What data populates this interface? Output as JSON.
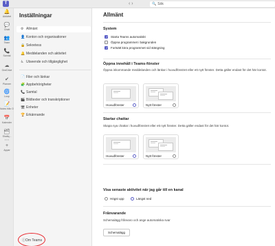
{
  "topbar": {
    "logo": "T",
    "nav": "‹ ›",
    "search": "Sök"
  },
  "rail": [
    {
      "icon": "🔔",
      "name": "bell-icon",
      "label": "Aktivitet"
    },
    {
      "icon": "💬",
      "name": "chat-icon",
      "label": "Chatt"
    },
    {
      "icon": "👥",
      "name": "teams-icon",
      "label": "Team"
    },
    {
      "icon": "📞",
      "name": "phone-icon",
      "label": "Samtal"
    },
    {
      "icon": "☁",
      "name": "onedrive-icon",
      "label": "OneDrive"
    },
    {
      "icon": "✔",
      "name": "planner-icon",
      "label": "Planner"
    },
    {
      "icon": "🌀",
      "name": "loop-icon",
      "label": "Loop"
    },
    {
      "icon": "📝",
      "name": "notes-icon",
      "label": "Notes från O..."
    },
    {
      "icon": "📅",
      "name": "calendar-icon",
      "label": "Kalender"
    },
    {
      "icon": "🗂",
      "name": "viva-icon",
      "label": "Shafiq..."
    },
    {
      "icon": "⋯",
      "name": "more-icon",
      "label": ""
    },
    {
      "icon": "+",
      "name": "apps-icon",
      "label": "Appar"
    }
  ],
  "settings": {
    "title": "Inställningar",
    "group1": [
      {
        "icon": "⚙",
        "name": "gear-icon",
        "label": "Allmänt"
      },
      {
        "icon": "👤",
        "name": "accounts-icon",
        "label": "Konton och organisationer"
      },
      {
        "icon": "🔒",
        "name": "lock-icon",
        "label": "Sekretess"
      },
      {
        "icon": "🔔",
        "name": "bell-icon",
        "label": "Meddelanden och aktivitet"
      },
      {
        "icon": "♿",
        "name": "accessibility-icon",
        "label": "Utseende och tillgänglighet"
      }
    ],
    "group2": [
      {
        "icon": "📄",
        "name": "file-icon",
        "label": "Filer och länkar"
      },
      {
        "icon": "🧩",
        "name": "apps-icon",
        "label": "Appbehörigheter"
      },
      {
        "icon": "📞",
        "name": "phone-icon",
        "label": "Samtal"
      },
      {
        "icon": "🎬",
        "name": "captions-icon",
        "label": "Bildtexter och transkriptioner"
      },
      {
        "icon": "🖥",
        "name": "devices-icon",
        "label": "Enheter"
      },
      {
        "icon": "🏆",
        "name": "recognition-icon",
        "label": "Erkännande"
      }
    ],
    "about": "Om Teams"
  },
  "content": {
    "title": "Allmänt",
    "system": {
      "title": "System",
      "options": [
        {
          "label": "Starta Teams automatiskt",
          "checked": true
        },
        {
          "label": "Öppna programmet i bakgrunden",
          "checked": false
        },
        {
          "label": "Fortsätt köra programmet vid stängning",
          "checked": true
        }
      ]
    },
    "open_content": {
      "title": "Öppna innehåll i Teams-fönster",
      "text": "Öppna inkommande meddelanden och länkar i huvudfönstret eller ett nytt fönster. Detta gäller endast för det här kontot.",
      "main_label": "Huvudfönster",
      "new_label": "Nytt fönster"
    },
    "start_chats": {
      "title": "Startar chattar",
      "text": "Skapa nya chattar i huvudfönstret eller ett nytt fönster. Detta gäller endast för det här kontot.",
      "main_label": "Huvudfönster",
      "new_label": "Nytt fönster"
    },
    "recent_activity": {
      "title": "Visa senaste aktivitet när jag går till en kanal",
      "option_top": "Högst upp",
      "option_bottom": "Längst ned"
    },
    "away": {
      "title": "Frånvarande",
      "text": "Schemalägg frånvaro och ange automatiska svar",
      "button": "Schemalägg"
    }
  },
  "colors": {
    "accent": "#5b5fc7",
    "highlight": "#e8262d"
  }
}
